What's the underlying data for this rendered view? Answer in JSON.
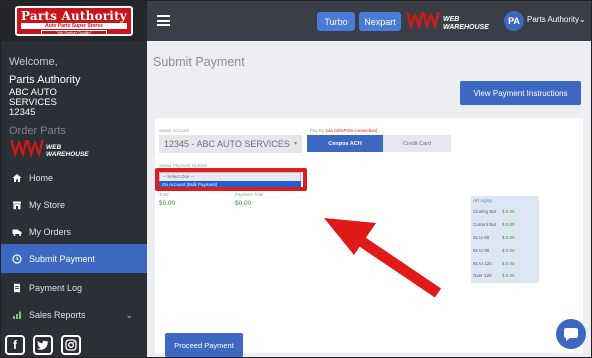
{
  "brand": {
    "logo_line1": "Parts Authority",
    "logo_line2": "Auto Parts Super Stores",
    "logo_line3": "\"We Deliver Quality\"",
    "ww_line1": "WEB",
    "ww_line2": "WAREHOUSE"
  },
  "sidebar": {
    "welcome": "Welcome,",
    "account_name": "Parts Authority",
    "account_lines": [
      "ABC AUTO",
      "SERVICES",
      "12345"
    ],
    "order_parts": "Order Parts",
    "nav": [
      {
        "label": "Home",
        "icon": "home-icon"
      },
      {
        "label": "My Store",
        "icon": "store-icon"
      },
      {
        "label": "My Orders",
        "icon": "truck-icon"
      },
      {
        "label": "Submit Payment",
        "icon": "clock-icon",
        "active": true
      },
      {
        "label": "Payment Log",
        "icon": "document-icon"
      },
      {
        "label": "Sales Reports",
        "icon": "chart-icon",
        "has_chevron": true
      }
    ],
    "social": [
      "facebook-icon",
      "twitter-icon",
      "instagram-icon"
    ]
  },
  "topbar": {
    "turbo": "Turbo",
    "nexpart": "Nexpart",
    "avatar_initials": "PA",
    "user_name": "Parts Authority"
  },
  "main": {
    "title": "Submit Payment",
    "instructions_button": "View Payment Instructions",
    "select_account_label": "Select Account",
    "select_account_value": "12345 - ABC AUTO SERVICES",
    "pay_by_label": "Pay By",
    "pay_by_warning": "(via CENPOS connection)",
    "pay_options": [
      "Cenpos ACH",
      "Credit Card"
    ],
    "payment_options_label": "Select Payment Options",
    "payment_options_placeholder": "-- Select One --",
    "payment_options_selected": "On Account (Bulk Payment)",
    "total_label": "Total",
    "total_value": "$0.00",
    "payment_total_label": "Payment Total",
    "payment_total_value": "$0.00",
    "ar_aging": {
      "title": "AR Aging",
      "rows": [
        {
          "label": "Closing Bal",
          "value": "$ 0.00"
        },
        {
          "label": "Current Bal",
          "value": "$ 0.00"
        },
        {
          "label": "31 to 60",
          "value": "$ 0.00"
        },
        {
          "label": "61 to 90",
          "value": "$ 0.00"
        },
        {
          "label": "91 to 120",
          "value": "$ 0.00"
        },
        {
          "label": "Over 120",
          "value": "$ 0.00"
        }
      ]
    },
    "proceed_button": "Proceed Payment"
  },
  "colors": {
    "sidebar_bg": "#2b2f36",
    "accent": "#3d68c1",
    "highlight": "#e11c1c",
    "amount_green": "#2e9b2e"
  }
}
